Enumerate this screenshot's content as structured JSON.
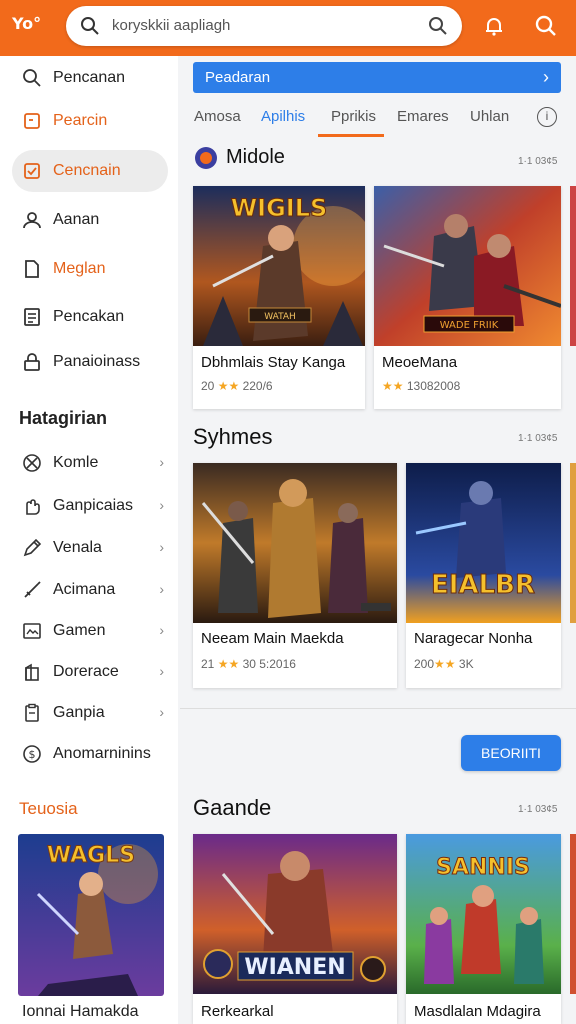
{
  "header": {
    "logo_text": "Yo°",
    "search_text": "koryskkii aapliagh"
  },
  "sidebar": {
    "items": [
      {
        "label": "Pencanan"
      },
      {
        "label": "Pearcin"
      },
      {
        "label": "Cencnain"
      },
      {
        "label": "Aanan"
      },
      {
        "label": "Meglan"
      },
      {
        "label": "Pencakan"
      },
      {
        "label": "Panaioinass"
      }
    ],
    "section_title": "Hatagirian",
    "categories": [
      {
        "label": "Komle"
      },
      {
        "label": "Ganpicaias"
      },
      {
        "label": "Venala"
      },
      {
        "label": "Acimana"
      },
      {
        "label": "Gamen"
      },
      {
        "label": "Dorerace"
      },
      {
        "label": "Ganpia"
      },
      {
        "label": "Anomarninins"
      }
    ],
    "featured_title": "Teuosia",
    "featured_card_title": "Ionnai Hamakda",
    "featured_art_text": "WAGLS"
  },
  "main": {
    "banner_text": "Peadaran",
    "tabs": [
      {
        "label": "Amosa"
      },
      {
        "label": "Apilhis"
      },
      {
        "label": "Pprikis"
      },
      {
        "label": "Emares"
      },
      {
        "label": "Uhlan"
      }
    ],
    "sections": [
      {
        "title": "Midole",
        "count": "1·1 03¢5",
        "cards": [
          {
            "title": "Dbhmlais Stay Kanga",
            "meta_left": "20",
            "meta_right": "220/6",
            "art_text": "WIGILS",
            "art_sub": "WATAH"
          },
          {
            "title": "MeoeMana",
            "meta_left": "",
            "meta_right": "13082008",
            "art_text": "",
            "art_sub": "WADE FRIIK"
          }
        ]
      },
      {
        "title": "Syhmes",
        "count": "1·1 03¢5",
        "cards": [
          {
            "title": "Neeam Main Maekda",
            "meta_left": "21",
            "meta_right": "30 5:2016",
            "art_text": "",
            "art_sub": ""
          },
          {
            "title": "Naragecar Nonha",
            "meta_left": "200",
            "meta_right": "3K",
            "art_text": "EIALBR",
            "art_sub": ""
          }
        ]
      },
      {
        "title": "Gaande",
        "count": "1·1 03¢5",
        "cards": [
          {
            "title": "Rerkearkal",
            "meta_left": "",
            "meta_right": "",
            "art_text": "WIANEN",
            "art_sub": ""
          },
          {
            "title": "Masdlalan Mdagira",
            "meta_left": "",
            "meta_right": "",
            "art_text": "SANNIS",
            "art_sub": ""
          }
        ]
      }
    ],
    "button_label": "BEORIITI",
    "info_glyph": "i"
  }
}
